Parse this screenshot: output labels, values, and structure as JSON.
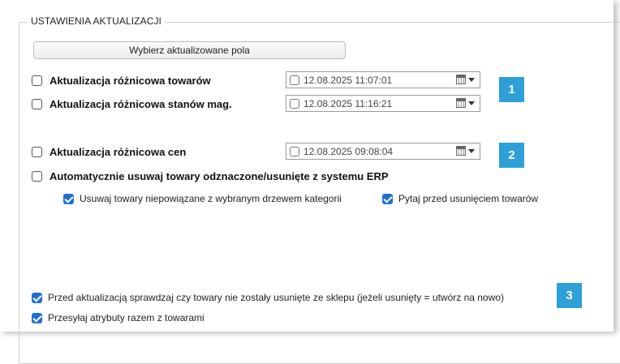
{
  "group_title": "USTAWIENIA AKTUALIZACJI",
  "select_fields_button": "Wybierz aktualizowane pola",
  "products_update": {
    "label": "Aktualizacja różnicowa towarów",
    "checked": false,
    "date": "12.08.2025 11:07:01"
  },
  "stock_update": {
    "label": "Aktualizacja różnicowa stanów mag.",
    "checked": false,
    "date": "12.08.2025 11:16:21"
  },
  "price_update": {
    "label": "Aktualizacja różnicowa cen",
    "checked": false,
    "date": "12.08.2025 09:08:04"
  },
  "auto_delete": {
    "label": "Automatycznie usuwaj towary odznaczone/usunięte z systemu ERP",
    "checked": false
  },
  "remove_unlinked": {
    "label": "Usuwaj towary niepowiązane z wybranym drzewem kategorii",
    "checked": true
  },
  "ask_before_delete": {
    "label": "Pytaj przed usunięciem towarów",
    "checked": true
  },
  "check_deleted": {
    "label": "Przed aktualizacją sprawdzaj czy towary nie zostały usunięte ze sklepu (jeżeli usunięty = utwórz na nowo)",
    "checked": true
  },
  "send_attributes": {
    "label": "Przesyłaj atrybuty razem z towarami",
    "checked": true
  },
  "badges": [
    "1",
    "2",
    "3"
  ],
  "colors": {
    "accent": "#1f6fd1",
    "badge": "#2f9fd8"
  },
  "icons": {
    "date_picker": "calendar-icon",
    "dropdown": "chevron-down-icon"
  }
}
